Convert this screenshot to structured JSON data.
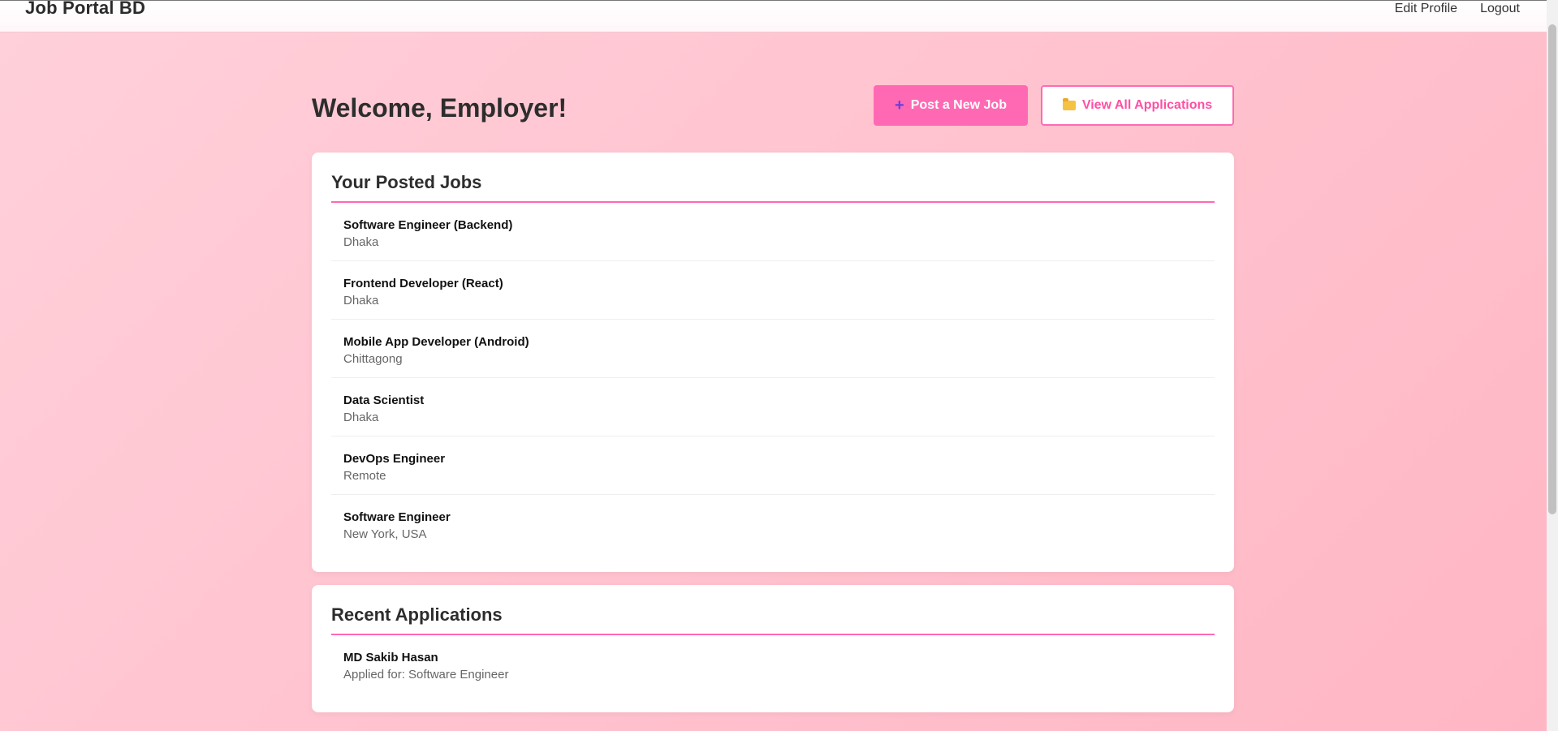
{
  "header": {
    "brand": "Job Portal BD",
    "nav": [
      {
        "label": "Edit Profile"
      },
      {
        "label": "Logout"
      }
    ]
  },
  "main": {
    "welcome": "Welcome, Employer!",
    "post_job_label": "Post a New Job",
    "view_apps_label": "View All Applications",
    "posted_jobs": {
      "title": "Your Posted Jobs",
      "items": [
        {
          "title": "Software Engineer (Backend)",
          "location": "Dhaka"
        },
        {
          "title": "Frontend Developer (React)",
          "location": "Dhaka"
        },
        {
          "title": "Mobile App Developer (Android)",
          "location": "Chittagong"
        },
        {
          "title": "Data Scientist",
          "location": "Dhaka"
        },
        {
          "title": "DevOps Engineer",
          "location": "Remote"
        },
        {
          "title": "Software Engineer",
          "location": "New York, USA"
        }
      ]
    },
    "recent_applications": {
      "title": "Recent Applications",
      "items": [
        {
          "name": "MD Sakib Hasan",
          "detail": "Applied for: Software Engineer"
        }
      ]
    }
  },
  "colors": {
    "accent": "#ff69b4",
    "background": "#ffc4d0"
  },
  "icons": {
    "post_job": "plus-icon",
    "view_apps": "folder-icon"
  }
}
